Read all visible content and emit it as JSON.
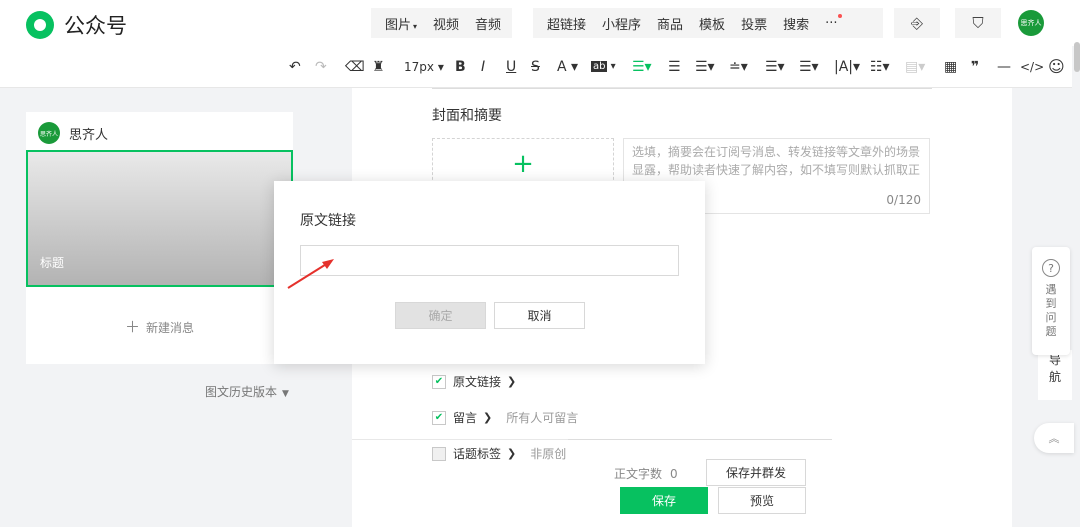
{
  "header": {
    "logo_text": "公众号",
    "menu_group_1": [
      "图片",
      "视频",
      "音频"
    ],
    "menu_group_1_caret": "▾",
    "menu_group_2": [
      "超链接",
      "小程序",
      "商品",
      "模板",
      "投票",
      "搜索"
    ],
    "more_label": "···",
    "avatar_text": "思齐人"
  },
  "toolbar": {
    "undo": "↶",
    "redo": "↷",
    "font_size": "17px",
    "bold": "B",
    "italic": "I",
    "underline": "U",
    "strike": "S",
    "font_color": "A",
    "bg_color": "ab",
    "quote": "❞",
    "hr": "—",
    "code": "</>",
    "emoji": "☺"
  },
  "left_panel": {
    "account_name": "思齐人",
    "avatar_text": "思齐人",
    "cover_title": "标题",
    "new_message": "新建消息",
    "history": "图文历史版本"
  },
  "editor": {
    "cover_section_title": "封面和摘要",
    "summary_placeholder": "选填，摘要会在订阅号消息、转发链接等文章外的场景显露，帮助读者快速了解内容，如不填写则默认抓取正文前54字",
    "summary_count": "0/120",
    "options": [
      {
        "label": "原文链接",
        "checked": true,
        "extra": ""
      },
      {
        "label": "留言",
        "checked": true,
        "extra": "所有人可留言"
      },
      {
        "label": "话题标签",
        "checked": false,
        "extra": "非原创"
      }
    ],
    "word_count_label": "正文字数",
    "word_count_value": "0",
    "save_and_send": "保存并群发",
    "save": "保存",
    "preview": "预览"
  },
  "side": {
    "help": "遇到问题",
    "nav": "导航",
    "back_top": "︽"
  },
  "dialog": {
    "title": "原文链接",
    "input_value": "",
    "confirm": "确定",
    "cancel": "取消"
  },
  "colors": {
    "brand_green": "#07c160",
    "annotation_red": "#e5312c"
  }
}
